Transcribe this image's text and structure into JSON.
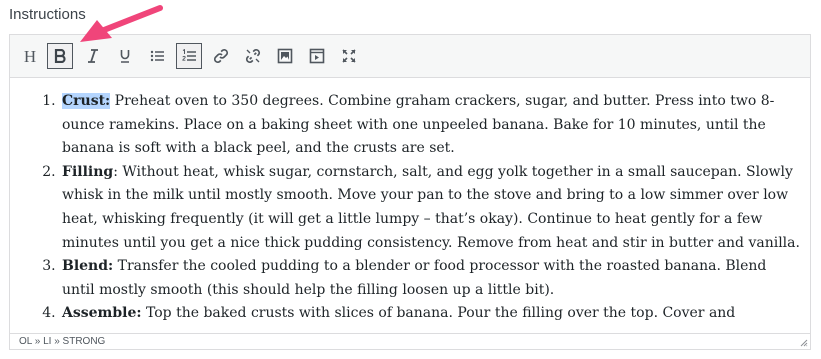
{
  "field": {
    "label": "Instructions"
  },
  "toolbar": {
    "heading_label": "H",
    "buttons": [
      {
        "name": "heading",
        "icon": "heading-icon"
      },
      {
        "name": "bold",
        "icon": "bold-icon",
        "active": true
      },
      {
        "name": "italic",
        "icon": "italic-icon"
      },
      {
        "name": "underline",
        "icon": "underline-icon"
      },
      {
        "name": "bulleted-list",
        "icon": "bullet-list-icon"
      },
      {
        "name": "numbered-list",
        "icon": "numbered-list-icon",
        "active": true
      },
      {
        "name": "link",
        "icon": "link-icon"
      },
      {
        "name": "unlink",
        "icon": "unlink-icon"
      },
      {
        "name": "image",
        "icon": "image-icon"
      },
      {
        "name": "video",
        "icon": "video-icon"
      },
      {
        "name": "fullscreen",
        "icon": "fullscreen-icon"
      }
    ]
  },
  "content": {
    "items": [
      {
        "title": "Crust:",
        "text": " Preheat oven to 350 degrees. Combine graham crackers, sugar, and butter. Press into two 8-ounce ramekins. Place on a baking sheet with one unpeeled banana. Bake for 10 minutes, until the banana is soft with a black peel, and the crusts are set."
      },
      {
        "title": "Filling",
        "text": ": Without heat, whisk sugar, cornstarch, salt, and egg yolk together in a small saucepan. Slowly whisk in the milk until mostly smooth. Move your pan to the stove and bring to a low simmer over low heat, whisking frequently (it will get a little lumpy – that’s okay). Continue to heat gently for a few minutes until you get a nice thick pudding consistency. Remove from heat and stir in butter and vanilla."
      },
      {
        "title": "Blend:",
        "text": " Transfer the cooled pudding to a blender or food processor with the roasted banana. Blend until mostly smooth (this should help the filling loosen up a little bit)."
      },
      {
        "title": "Assemble:",
        "text": " Top the baked crusts with slices of banana. Pour the filling over the top. Cover and"
      }
    ]
  },
  "statusbar": {
    "path": "OL » LI » STRONG"
  },
  "colors": {
    "annotation_arrow": "#f0457a",
    "selection": "#b4d5fe",
    "toolbar_bg": "#f6f7f7"
  }
}
